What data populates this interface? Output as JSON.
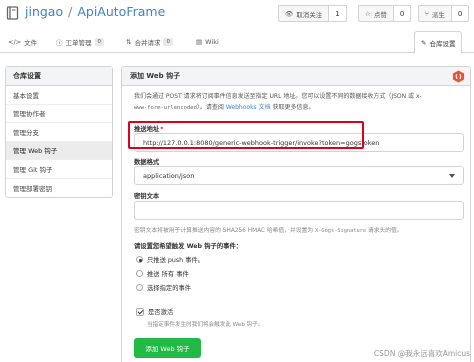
{
  "header": {
    "owner": "jingao",
    "separator": "/",
    "repo": "ApiAutoFrame",
    "unwatch_label": "取消关注",
    "unwatch_count": "1",
    "star_label": "点赞",
    "star_count": "0",
    "fork_label": "派生",
    "fork_count": "0"
  },
  "tabs": [
    {
      "label": "文件",
      "icon": "code-icon"
    },
    {
      "label": "工单管理",
      "badge": "0",
      "icon": "issue-icon"
    },
    {
      "label": "合并请求",
      "badge": "0",
      "icon": "pull-request-icon"
    },
    {
      "label": "Wiki",
      "icon": "book-icon"
    },
    {
      "label": "仓库设置",
      "icon": "tools-icon",
      "active": true
    }
  ],
  "sidebar": {
    "title": "仓库设置",
    "items": [
      {
        "label": "基本设置"
      },
      {
        "label": "管理协作者"
      },
      {
        "label": "管理分支"
      },
      {
        "label": "管理 Web 钩子",
        "active": true
      },
      {
        "label": "管理 Git 钩子"
      },
      {
        "label": "管理部署密钥"
      }
    ]
  },
  "panel": {
    "title": "添加 Web 钩子",
    "desc1": "我们会通过 POST 请求将订阅事件信息发送至指定 URL 地址。您可以设置不同的数据接收方式（JSON 或 x-",
    "desc2_mono": "www-form-urlencoded",
    "desc2_mid": "）。请查阅 ",
    "desc2_link": "Webhooks 文档",
    "desc2_end": " 获取更多信息。",
    "payload_url_label": "推送地址",
    "payload_url_required": "*",
    "payload_url_value": "http://127.0.0.1:8080/generic-webhook-trigger/invoke?token=gogstoken",
    "content_type_label": "数据格式",
    "content_type_value": "application/json",
    "secret_label": "密钥文本",
    "secret_value": "",
    "secret_help_1": "密钥文本将被用于计算推送内容的 SHA256 HMAC 哈希值，并设置为 ",
    "secret_help_mono": "X-Gogs-Signature",
    "secret_help_2": " 请求头的值。",
    "events_label": "请设置您希望触发 Web 钩子的事件：",
    "events": [
      {
        "label": "只推送 push 事件。",
        "checked": true
      },
      {
        "label": "推送 所有 事件",
        "sub": "",
        "checked": false
      },
      {
        "label": "选择指定的事件",
        "checked": false
      }
    ],
    "active_label": "是否激活",
    "active_checked": true,
    "active_help": "当指定事件发生时我们将会触发此 Web 钩子。",
    "submit_label": "添加 Web 钩子"
  },
  "watermark": "CSDN @我永远喜欢Amicus",
  "colors": {
    "link": "#4183c4",
    "primary_green": "#21ba45",
    "highlight_red": "#e0001b",
    "gogs_orange": "#f05133"
  }
}
